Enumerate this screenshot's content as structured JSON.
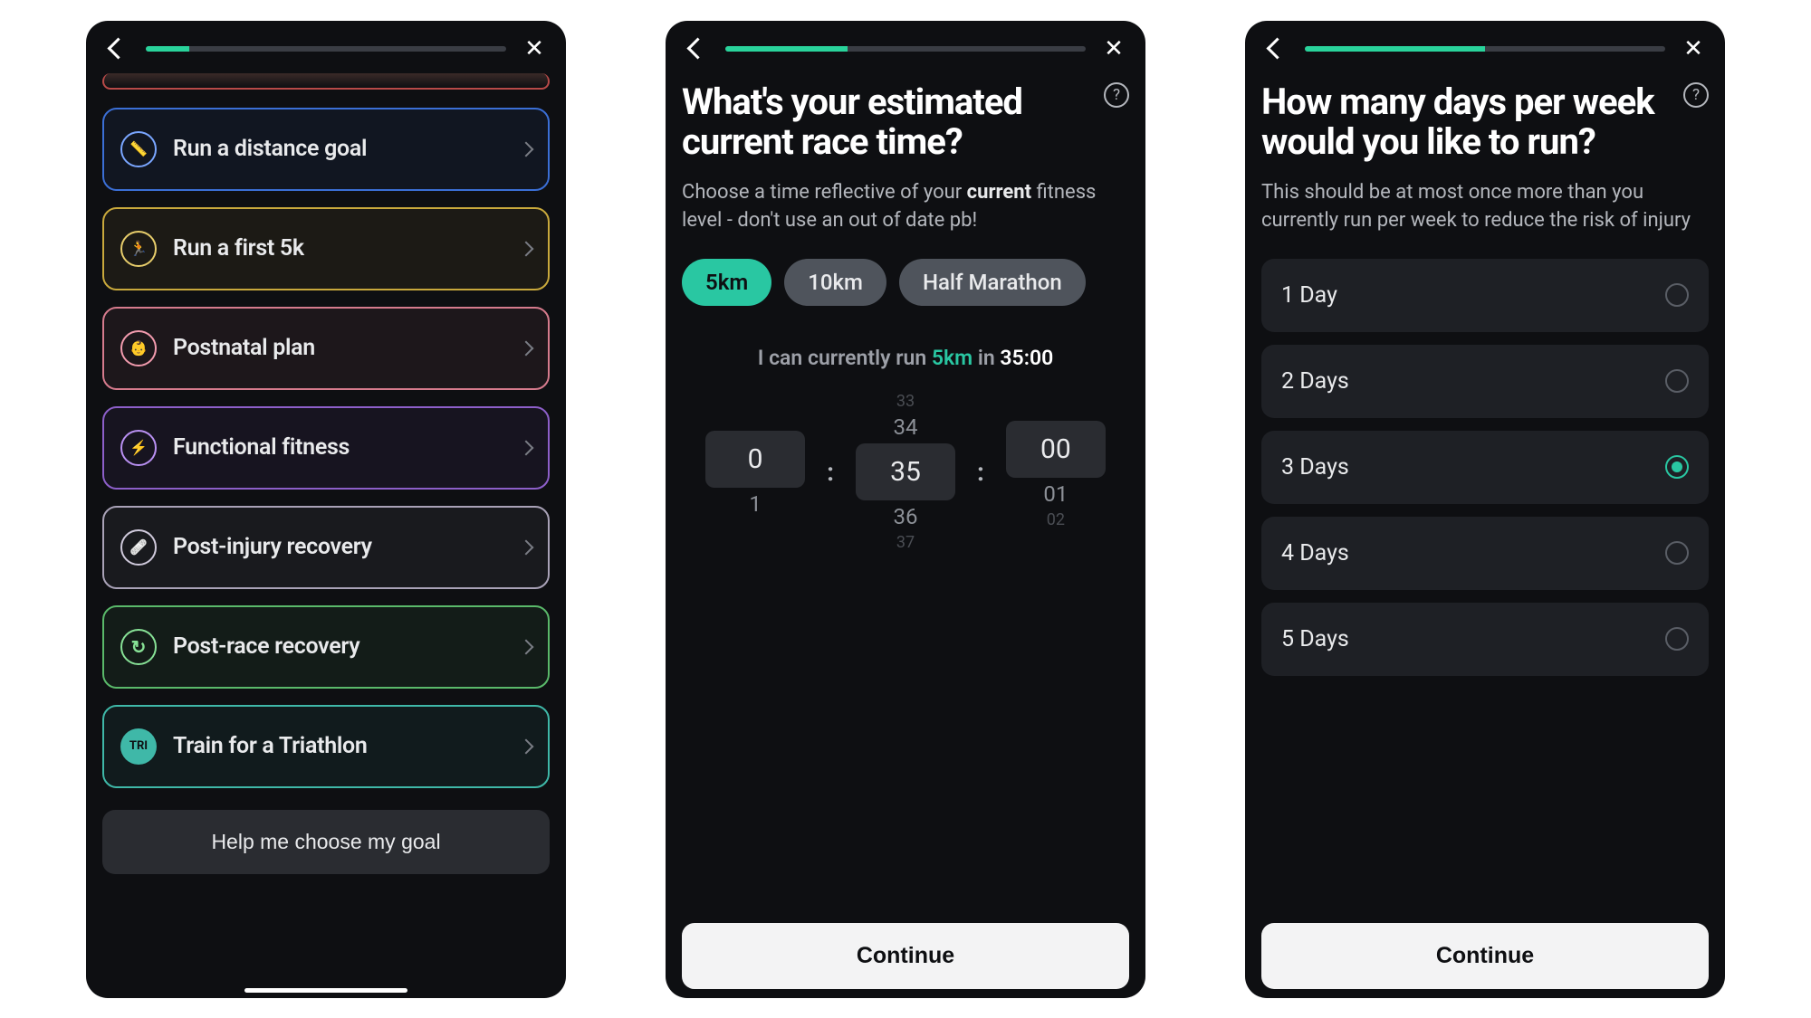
{
  "screen1": {
    "progress_pct": 12,
    "goals": [
      {
        "label": "Run a distance goal",
        "icon": "ruler-icon",
        "cls": "goal-blue"
      },
      {
        "label": "Run a first 5k",
        "icon": "run-icon",
        "cls": "goal-yellow"
      },
      {
        "label": "Postnatal plan",
        "icon": "baby-icon",
        "cls": "goal-pink"
      },
      {
        "label": "Functional fitness",
        "icon": "flex-icon",
        "cls": "goal-purple"
      },
      {
        "label": "Post-injury recovery",
        "icon": "bandage-icon",
        "cls": "goal-light"
      },
      {
        "label": "Post-race recovery",
        "icon": "refresh-icon",
        "cls": "goal-green"
      },
      {
        "label": "Train for a Triathlon",
        "icon": "tri-icon",
        "cls": "goal-teal"
      }
    ],
    "help_button": "Help me choose my goal"
  },
  "screen2": {
    "progress_pct": 34,
    "title": "What's your estimated current race time?",
    "sub_pre": "Choose a time reflective of your ",
    "sub_bold": "current",
    "sub_post": " fitness level - don't use an out of date pb!",
    "chips": [
      "5km",
      "10km",
      "Half Marathon"
    ],
    "chip_selected": "5km",
    "summary_pre": "I can currently run ",
    "summary_distance": "5km",
    "summary_mid": " in ",
    "summary_time": "35:00",
    "wheel_hours": {
      "faint_top": "",
      "dim_top": "",
      "sel": "0",
      "dim_bot": "1",
      "faint_bot": ""
    },
    "wheel_min": {
      "faint_top": "33",
      "dim_top": "34",
      "sel": "35",
      "dim_bot": "36",
      "faint_bot": "37"
    },
    "wheel_sec": {
      "faint_top": "",
      "dim_top": "",
      "sel": "00",
      "dim_bot": "01",
      "faint_bot": "02"
    },
    "continue": "Continue"
  },
  "screen3": {
    "progress_pct": 50,
    "title": "How many days per week would you like to run?",
    "sub": "This should be at most once more than you currently run per week to reduce the risk of injury",
    "options": [
      "1 Day",
      "2 Days",
      "3 Days",
      "4 Days",
      "5 Days"
    ],
    "selected": "3 Days",
    "continue": "Continue"
  }
}
